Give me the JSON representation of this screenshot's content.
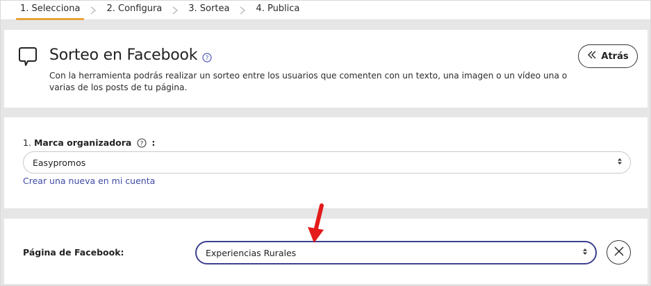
{
  "stepper": {
    "steps": [
      {
        "label": "1. Selecciona",
        "active": true
      },
      {
        "label": "2. Configura",
        "active": false
      },
      {
        "label": "3. Sortea",
        "active": false
      },
      {
        "label": "4. Publica",
        "active": false
      }
    ],
    "active_color": "#e8a23a"
  },
  "header": {
    "title": "Sorteo en Facebook",
    "description": "Con la herramienta podrás realizar un sorteo entre los usuarios que comenten con un texto, una imagen o un vídeo una o varias de los posts de tu página.",
    "back_label": "Atrás",
    "icons": {
      "main": "chat-bubble-icon",
      "help": "help-circle-icon",
      "back": "double-chevron-left-icon"
    }
  },
  "brand_field": {
    "number": "1.",
    "label": "Marca organizadora",
    "suffix": ":",
    "selected": "Easypromos",
    "create_link": "Crear una nueva en mi cuenta"
  },
  "page_field": {
    "label": "Página de Facebook:",
    "selected": "Experiencias Rurales",
    "accent_color": "#3b3f8f",
    "icons": {
      "clear": "close-circle-icon",
      "annotation": "red-arrow-icon"
    }
  },
  "colors": {
    "link": "#3f4aa6",
    "annotation": "#e31b1b",
    "background": "#e6e6e6"
  }
}
